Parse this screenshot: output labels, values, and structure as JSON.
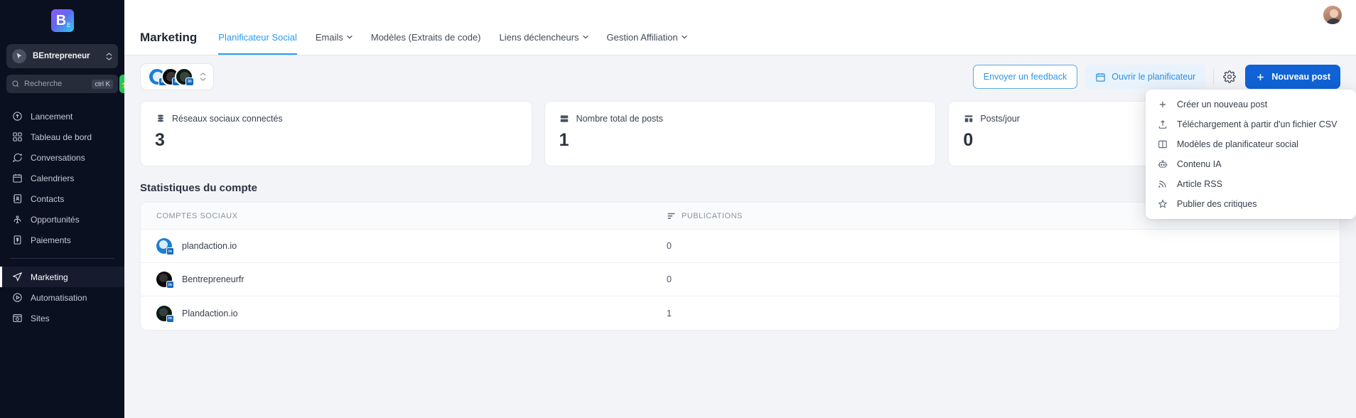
{
  "sidebar": {
    "logo": {
      "letter": "B",
      "sub": "E",
      "name": "logo-bentrepreneur"
    },
    "org": {
      "label": "BEntrepreneur",
      "icon": "cursor-icon"
    },
    "search": {
      "placeholder": "Recherche",
      "shortcut": "ctrl K",
      "icon": "search-icon",
      "bolt_icon": "bolt-icon"
    },
    "items": [
      {
        "label": "Lancement",
        "icon": "rocket-icon",
        "active": false
      },
      {
        "label": "Tableau de bord",
        "icon": "dashboard-icon",
        "active": false
      },
      {
        "label": "Conversations",
        "icon": "chat-icon",
        "active": false
      },
      {
        "label": "Calendriers",
        "icon": "calendar-icon",
        "active": false
      },
      {
        "label": "Contacts",
        "icon": "contacts-icon",
        "active": false
      },
      {
        "label": "Opportunités",
        "icon": "opportunities-icon",
        "active": false
      },
      {
        "label": "Paiements",
        "icon": "payments-icon",
        "active": false
      },
      {
        "label": "Marketing",
        "icon": "send-icon",
        "active": true
      },
      {
        "label": "Automatisation",
        "icon": "automation-icon",
        "active": false
      },
      {
        "label": "Sites",
        "icon": "sites-icon",
        "active": false
      }
    ]
  },
  "topbar": {
    "title": "Marketing",
    "tabs": [
      {
        "label": "Planificateur Social",
        "active": true,
        "caret": false
      },
      {
        "label": "Emails",
        "active": false,
        "caret": true
      },
      {
        "label": "Modèles (Extraits de code)",
        "active": false,
        "caret": false
      },
      {
        "label": "Liens déclencheurs",
        "active": false,
        "caret": true
      },
      {
        "label": "Gestion Affiliation",
        "active": false,
        "caret": true
      }
    ],
    "avatar": "user-avatar"
  },
  "toolbar": {
    "accounts": [
      {
        "name": "plandaction.io",
        "network": "linkedin"
      },
      {
        "name": "Bentrepreneurfr",
        "network": "linkedin"
      },
      {
        "name": "Plandaction.io",
        "network": "linkedin"
      }
    ],
    "feedback_label": "Envoyer un feedback",
    "planner_label": "Ouvrir le planificateur",
    "planner_icon": "calendar-icon",
    "settings_icon": "gear-icon",
    "new_post_label": "Nouveau post",
    "new_post_icon": "plus-icon"
  },
  "dropdown": {
    "items": [
      {
        "label": "Créer un nouveau post",
        "icon": "plus-icon"
      },
      {
        "label": "Téléchargement à partir d'un fichier CSV",
        "icon": "upload-icon"
      },
      {
        "label": "Modèles de planificateur social",
        "icon": "layout-icon"
      },
      {
        "label": "Contenu IA",
        "icon": "robot-icon"
      },
      {
        "label": "Article RSS",
        "icon": "rss-icon"
      },
      {
        "label": "Publier des critiques",
        "icon": "star-icon"
      }
    ]
  },
  "cards": [
    {
      "label": "Réseaux sociaux connectés",
      "value": "3",
      "icon": "stack-icon"
    },
    {
      "label": "Nombre total de posts",
      "value": "1",
      "icon": "server-icon"
    },
    {
      "label": "Posts/jour",
      "value": "0",
      "icon": "bars-icon"
    }
  ],
  "stats": {
    "title": "Statistiques du compte",
    "columns": [
      "COMPTES SOCIAUX",
      "PUBLICATIONS"
    ],
    "column_icon": "list-icon",
    "rows": [
      {
        "account": "plandaction.io",
        "publications": "0",
        "avatar": "blue"
      },
      {
        "account": "Bentrepreneurfr",
        "publications": "0",
        "avatar": "black"
      },
      {
        "account": "Plandaction.io",
        "publications": "1",
        "avatar": "dark"
      }
    ]
  },
  "colors": {
    "accent": "#1062d6",
    "link": "#2a9bf0",
    "sidebar_bg": "#0b1020",
    "page_bg": "#f3f4f7"
  }
}
